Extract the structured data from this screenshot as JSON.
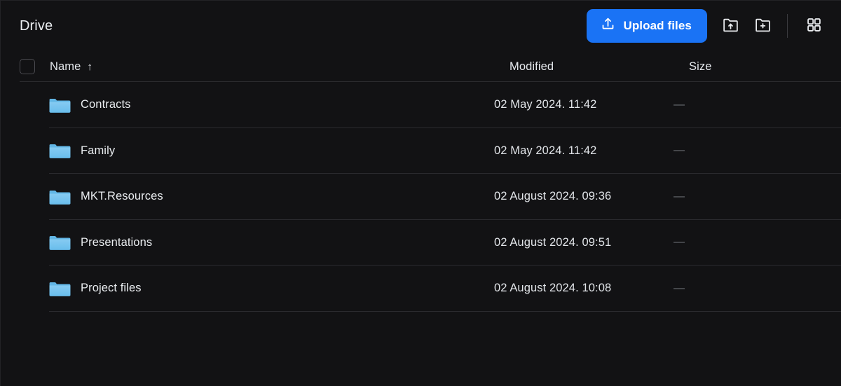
{
  "header": {
    "title": "Drive",
    "upload_button_label": "Upload files",
    "upload_icon": "upload-tray-icon",
    "upload_folder_icon": "folder-upload-icon",
    "new_folder_icon": "folder-plus-icon",
    "grid_view_icon": "grid-view-icon",
    "accent_color": "#1a73f5"
  },
  "table": {
    "select_all_checkbox": "unchecked",
    "columns": {
      "name": "Name",
      "sort_indicator": "↑",
      "modified": "Modified",
      "size": "Size"
    },
    "rows": [
      {
        "icon": "folder-icon",
        "name": "Contracts",
        "modified": "02 May 2024. 11:42",
        "size": "—"
      },
      {
        "icon": "folder-icon",
        "name": "Family",
        "modified": "02 May 2024. 11:42",
        "size": "—"
      },
      {
        "icon": "folder-icon",
        "name": "MKT.Resources",
        "modified": "02 August 2024. 09:36",
        "size": "—"
      },
      {
        "icon": "folder-icon",
        "name": "Presentations",
        "modified": "02 August 2024. 09:51",
        "size": "—"
      },
      {
        "icon": "folder-icon",
        "name": "Project files",
        "modified": "02 August 2024. 10:08",
        "size": "—"
      }
    ]
  }
}
